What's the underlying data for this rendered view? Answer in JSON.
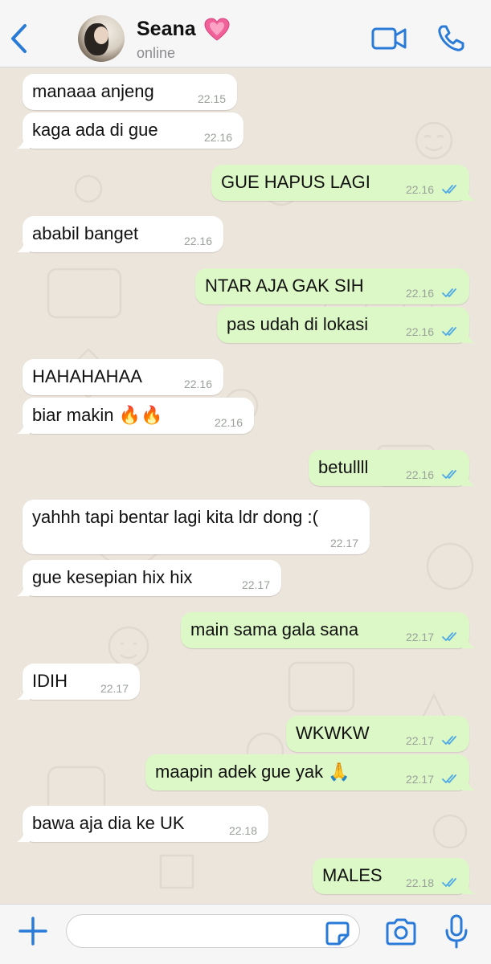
{
  "header": {
    "contact_name": "Seana",
    "status": "online",
    "icons": {
      "back": "chevron-left-icon",
      "heart": "heart-icon",
      "video": "video-call-icon",
      "call": "phone-icon"
    }
  },
  "colors": {
    "accent": "#2a7bd8",
    "outgoing_bubble": "#dcf8c6",
    "incoming_bubble": "#ffffff",
    "wallpaper": "#ece5dc",
    "read_tick": "#4fa9e6"
  },
  "messages": [
    {
      "dir": "in",
      "text": "manaaa anjeng",
      "time": "22.15"
    },
    {
      "dir": "in",
      "text": "kaga ada di gue",
      "time": "22.16"
    },
    {
      "dir": "out",
      "text": "GUE HAPUS LAGI",
      "time": "22.16",
      "read": true
    },
    {
      "dir": "in",
      "text": "ababil banget",
      "time": "22.16"
    },
    {
      "dir": "out",
      "text": "NTAR AJA GAK SIH",
      "time": "22.16",
      "read": true
    },
    {
      "dir": "out",
      "text": "pas udah di lokasi",
      "time": "22.16",
      "read": true
    },
    {
      "dir": "in",
      "text": "HAHAHAHAA",
      "time": "22.16"
    },
    {
      "dir": "in",
      "text": "biar makin 🔥🔥",
      "time": "22.16"
    },
    {
      "dir": "out",
      "text": "betullll",
      "time": "22.16",
      "read": true
    },
    {
      "dir": "in",
      "text": "yahhh tapi bentar lagi kita ldr dong :(",
      "time": "22.17"
    },
    {
      "dir": "in",
      "text": "gue kesepian hix hix",
      "time": "22.17"
    },
    {
      "dir": "out",
      "text": "main sama gala sana",
      "time": "22.17",
      "read": true
    },
    {
      "dir": "in",
      "text": "IDIH",
      "time": "22.17"
    },
    {
      "dir": "out",
      "text": "WKWKW",
      "time": "22.17",
      "read": true
    },
    {
      "dir": "out",
      "text": "maapin adek gue yak 🙏",
      "time": "22.17",
      "read": true
    },
    {
      "dir": "in",
      "text": "bawa aja dia ke UK",
      "time": "22.18"
    },
    {
      "dir": "out",
      "text": "MALES",
      "time": "22.18",
      "read": true
    }
  ],
  "footer": {
    "input_value": "",
    "icons": {
      "add": "plus-icon",
      "sticker": "sticker-icon",
      "camera": "camera-icon",
      "mic": "microphone-icon"
    }
  }
}
